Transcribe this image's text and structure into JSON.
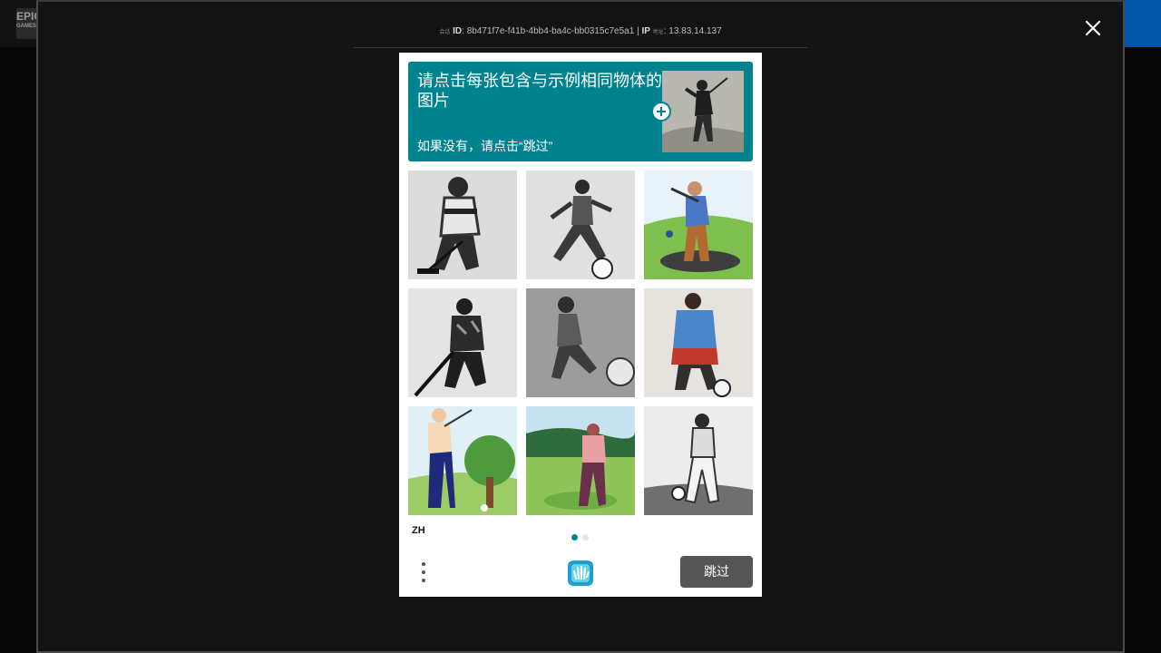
{
  "background": {
    "logo_text": "EPIC",
    "logo_sub": "GAMES"
  },
  "modal": {
    "session_label_prefix": "会话",
    "session_id_label": "ID",
    "session_id": "8b471f7e-f41b-4bb4-ba4c-bb0315c7e5a1",
    "ip_label": "IP",
    "ip_suffix": "地址",
    "ip_value": "13.83.14.137",
    "close_icon": "close-icon"
  },
  "captcha": {
    "prompt_title": "请点击每张包含与示例相同物体的图片",
    "prompt_subtitle": "如果没有，请点击“跳过”",
    "example_image": "golfer-sketch",
    "grid_images": [
      "hockey-player-sketch",
      "soccer-player-sketch",
      "golfer-blue-shirt",
      "hockey-player-dark",
      "soccer-player-grey",
      "soccer-player-blue-red",
      "golfer-tree",
      "golfer-green-course",
      "soccer-player-pencil"
    ],
    "language": "ZH",
    "skip_label": "跳过",
    "colors": {
      "accent": "#00838f",
      "skip": "#555555"
    }
  }
}
